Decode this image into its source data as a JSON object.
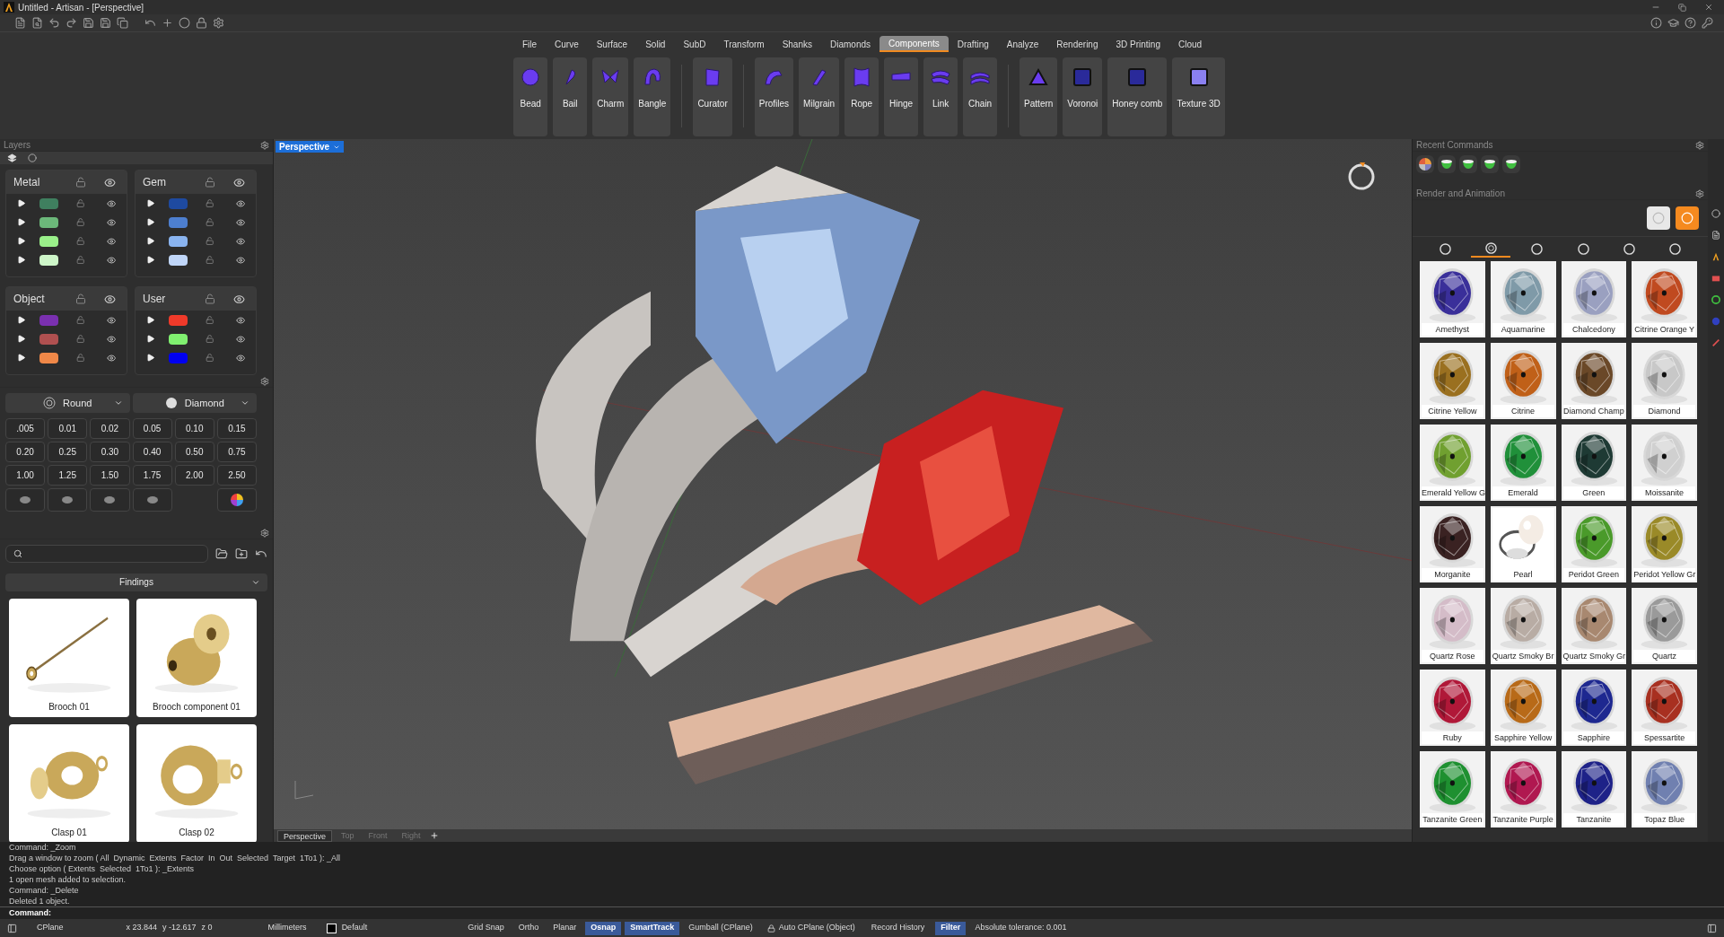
{
  "window": {
    "title": "Untitled - Artisan - [Perspective]"
  },
  "menu": [
    {
      "label": "File",
      "selected": false
    },
    {
      "label": "Curve",
      "selected": false
    },
    {
      "label": "Surface",
      "selected": false
    },
    {
      "label": "Solid",
      "selected": false
    },
    {
      "label": "SubD",
      "selected": false
    },
    {
      "label": "Transform",
      "selected": false
    },
    {
      "label": "Shanks",
      "selected": false
    },
    {
      "label": "Diamonds",
      "selected": false
    },
    {
      "label": "Components",
      "selected": true
    },
    {
      "label": "Drafting",
      "selected": false
    },
    {
      "label": "Analyze",
      "selected": false
    },
    {
      "label": "Rendering",
      "selected": false
    },
    {
      "label": "3D Printing",
      "selected": false
    },
    {
      "label": "Cloud",
      "selected": false
    }
  ],
  "ribbon": {
    "groups": [
      [
        "Bead",
        "Bail",
        "Charm",
        "Bangle"
      ],
      [
        "Curator"
      ],
      [
        "Profiles",
        "Milgrain",
        "Rope",
        "Hinge",
        "Link",
        "Chain"
      ],
      [
        "Pattern",
        "Voronoi",
        "Honey comb",
        "Texture 3D"
      ]
    ]
  },
  "layers": {
    "title": "Layers",
    "groups": [
      {
        "name": "Metal",
        "rows": [
          {
            "color": "#3f7f5f"
          },
          {
            "color": "#6cb87a"
          },
          {
            "color": "#9af08a"
          },
          {
            "color": "#cdf5c8"
          }
        ]
      },
      {
        "name": "Gem",
        "rows": [
          {
            "color": "#1e4aa0"
          },
          {
            "color": "#4d7fd0"
          },
          {
            "color": "#8ab4f0"
          },
          {
            "color": "#c0d6f8"
          }
        ]
      },
      {
        "name": "Object",
        "rows": [
          {
            "color": "#7a30b0"
          },
          {
            "color": "#b05050"
          },
          {
            "color": "#f08848"
          }
        ]
      },
      {
        "name": "User",
        "rows": [
          {
            "color": "#f03a2a"
          },
          {
            "color": "#80f070"
          },
          {
            "color": "#0000f0"
          }
        ]
      }
    ]
  },
  "gem_sizes": {
    "shape": "Round",
    "material": "Diamond",
    "values": [
      ".005",
      "0.01",
      "0.02",
      "0.05",
      "0.10",
      "0.15",
      "0.20",
      "0.25",
      "0.30",
      "0.40",
      "0.50",
      "0.75",
      "1.00",
      "1.25",
      "1.50",
      "1.75",
      "2.00",
      "2.50"
    ]
  },
  "findings": {
    "category": "Findings",
    "items": [
      {
        "label": "Brooch 01"
      },
      {
        "label": "Brooch component 01"
      },
      {
        "label": "Clasp 01"
      },
      {
        "label": "Clasp 02"
      }
    ]
  },
  "viewport": {
    "label": "Perspective",
    "tabs": [
      {
        "label": "Perspective",
        "selected": true
      },
      {
        "label": "Top",
        "selected": false
      },
      {
        "label": "Front",
        "selected": false
      },
      {
        "label": "Right",
        "selected": false
      }
    ]
  },
  "recent_commands": {
    "title": "Recent Commands"
  },
  "render": {
    "title": "Render and Animation",
    "tabs": [
      {
        "selected": false
      },
      {
        "selected": true
      },
      {
        "selected": false
      },
      {
        "selected": false
      },
      {
        "selected": false
      },
      {
        "selected": false
      }
    ],
    "materials": [
      {
        "label": "Amethyst",
        "color": "#3a2f9a",
        "kind": "gem"
      },
      {
        "label": "Aquamarine",
        "color": "#7f9aa8",
        "kind": "gem"
      },
      {
        "label": "Chalcedony",
        "color": "#9aa0c0",
        "kind": "gem"
      },
      {
        "label": "Citrine Orange Y",
        "color": "#c04a20",
        "kind": "gem"
      },
      {
        "label": "Citrine Yellow",
        "color": "#9a7020",
        "kind": "gem"
      },
      {
        "label": "Citrine",
        "color": "#c06018",
        "kind": "gem"
      },
      {
        "label": "Diamond Champ",
        "color": "#6a4828",
        "kind": "gem"
      },
      {
        "label": "Diamond",
        "color": "#c8c8c8",
        "kind": "gem"
      },
      {
        "label": "Emerald Yellow G",
        "color": "#70a030",
        "kind": "gem"
      },
      {
        "label": "Emerald",
        "color": "#20903a",
        "kind": "gem"
      },
      {
        "label": "Green",
        "color": "#1e3a34",
        "kind": "gem"
      },
      {
        "label": "Moissanite",
        "color": "#d0d0d0",
        "kind": "gem"
      },
      {
        "label": "Morganite",
        "color": "#3a2222",
        "kind": "gem"
      },
      {
        "label": "Pearl",
        "color": "#f4ece4",
        "kind": "pearl"
      },
      {
        "label": "Peridot Green",
        "color": "#4a9a2a",
        "kind": "gem"
      },
      {
        "label": "Peridot Yellow Gr",
        "color": "#9a8a28",
        "kind": "gem"
      },
      {
        "label": "Quartz Rose",
        "color": "#d4bcc8",
        "kind": "gem"
      },
      {
        "label": "Quartz Smoky Br",
        "color": "#b8aca4",
        "kind": "gem"
      },
      {
        "label": "Quartz Smoky Gr",
        "color": "#a88870",
        "kind": "gem"
      },
      {
        "label": "Quartz",
        "color": "#9a9a9a",
        "kind": "gem"
      },
      {
        "label": "Ruby",
        "color": "#b01838",
        "kind": "gem"
      },
      {
        "label": "Sapphire Yellow",
        "color": "#b86a18",
        "kind": "gem"
      },
      {
        "label": "Sapphire",
        "color": "#1e2890",
        "kind": "gem"
      },
      {
        "label": "Spessartite",
        "color": "#a83020",
        "kind": "gem"
      },
      {
        "label": "Tanzanite Green",
        "color": "#1e9030",
        "kind": "gem"
      },
      {
        "label": "Tanzanite Purple",
        "color": "#b01850",
        "kind": "gem"
      },
      {
        "label": "Tanzanite",
        "color": "#1e2288",
        "kind": "gem"
      },
      {
        "label": "Topaz Blue",
        "color": "#7080b0",
        "kind": "gem"
      }
    ]
  },
  "command_history": [
    "Command: _Zoom",
    "Drag a window to zoom ( All  Dynamic  Extents  Factor  In  Out  Selected  Target  1To1 ): _All",
    "Choose option ( Extents  Selected  1To1 ): _Extents",
    "1 open mesh added to selection.",
    "Command: _Delete",
    "Deleted 1 object."
  ],
  "command_prompt": "Command:",
  "status_bar": {
    "cplane": "CPlane",
    "x": "x 23.844",
    "y": "y -12.617",
    "z": "z 0",
    "units": "Millimeters",
    "layer": "Default",
    "toggles": [
      {
        "label": "Grid Snap",
        "on": false
      },
      {
        "label": "Ortho",
        "on": false
      },
      {
        "label": "Planar",
        "on": false
      },
      {
        "label": "Osnap",
        "on": true
      },
      {
        "label": "SmartTrack",
        "on": true
      },
      {
        "label": "Gumball (CPlane)",
        "on": false
      }
    ],
    "auto_cplane": "Auto CPlane (Object)",
    "history": "Record History",
    "filter": {
      "label": "Filter",
      "on": true
    },
    "tolerance": "Absolute tolerance: 0.001"
  }
}
